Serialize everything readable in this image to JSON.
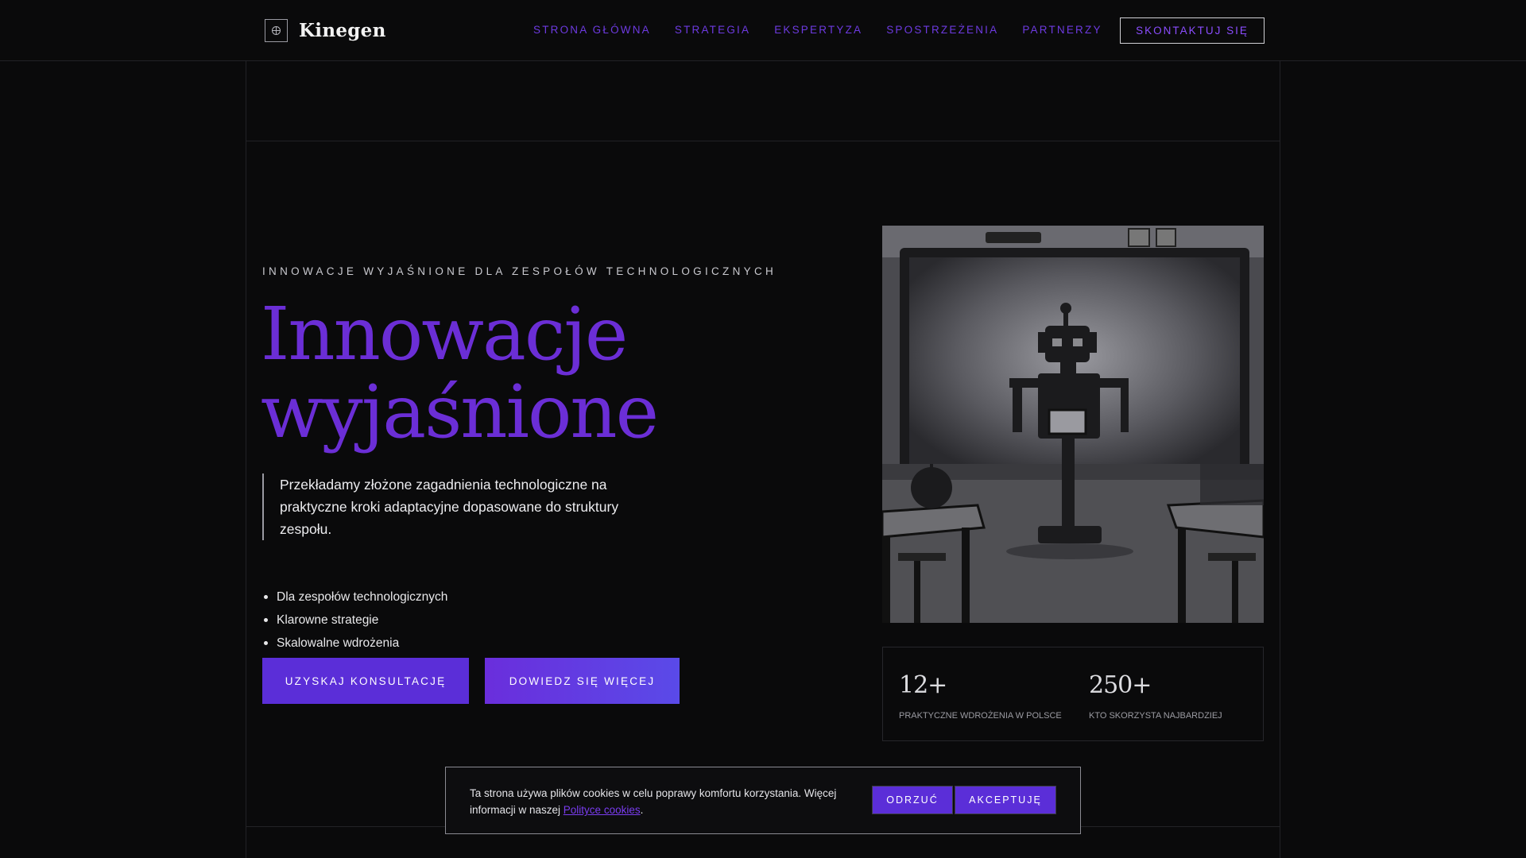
{
  "brand": {
    "name": "Kinegen"
  },
  "nav": {
    "items": [
      "STRONA GŁÓWNA",
      "STRATEGIA",
      "EKSPERTYZA",
      "SPOSTRZEŻENIA",
      "PARTNERZY"
    ],
    "cta": "SKONTAKTUJ SIĘ"
  },
  "hero": {
    "eyebrow": "INNOWACJE WYJAŚNIONE DLA ZESPOŁÓW TECHNOLOGICZNYCH",
    "title_line1": "Innowacje",
    "title_line2": "wyjaśnione",
    "lede": "Przekładamy złożone zagadnienia technologiczne na praktyczne kroki adaptacyjne dopasowane do struktury zespołu.",
    "bullets": [
      "Dla zespołów technologicznych",
      "Klarowne strategie",
      "Skalowalne wdrożenia"
    ],
    "primary_button": "UZYSKAJ KONSULTACJĘ",
    "secondary_button": "DOWIEDZ SIĘ WIĘCEJ"
  },
  "stats": [
    {
      "value": "12+",
      "label": "PRAKTYCZNE WDROŻENIA W POLSCE"
    },
    {
      "value": "250+",
      "label": "KTO SKORZYSTA NAJBARDZIEJ"
    }
  ],
  "cookie": {
    "text_before": "Ta strona używa plików cookies w celu poprawy komfortu korzystania. Więcej informacji w naszej ",
    "link_text": "Polityce cookies",
    "text_after": ".",
    "decline": "ODRZUĆ",
    "accept": "AKCEPTUJĘ"
  },
  "colors": {
    "accent": "#5b2ed8",
    "heading": "#6b2ed6",
    "background": "#0a0a0b"
  }
}
